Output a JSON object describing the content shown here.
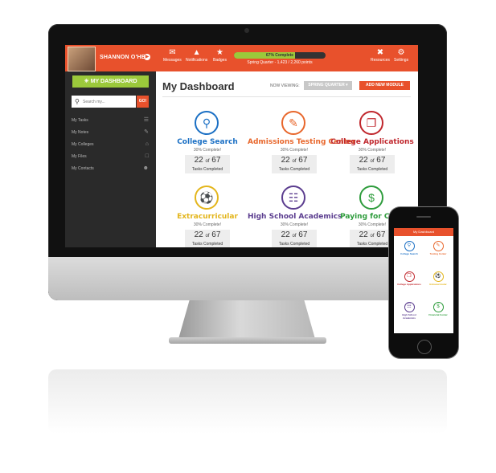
{
  "topbar": {
    "user_name": "SHANNON O'HER",
    "nav": [
      {
        "label": "Messages",
        "icon": "messages-icon"
      },
      {
        "label": "Notifications",
        "icon": "notifications-icon"
      },
      {
        "label": "Badges",
        "icon": "trophy-icon"
      },
      {
        "label": "Resources",
        "icon": "tools-icon"
      },
      {
        "label": "Settings",
        "icon": "gear-icon"
      }
    ],
    "progress": {
      "label": "67% Complete",
      "percent": 0.67,
      "sub": "Spring Quarter - 1,423 / 2,260 points"
    }
  },
  "sidebar": {
    "dashboard_label": "MY DASHBOARD",
    "search_placeholder": "Search my...",
    "go_label": "GO!",
    "items": [
      {
        "label": "My Tasks",
        "icon": "tasks-icon"
      },
      {
        "label": "My Notes",
        "icon": "notes-icon"
      },
      {
        "label": "My Colleges",
        "icon": "college-icon"
      },
      {
        "label": "My Files",
        "icon": "folder-icon"
      },
      {
        "label": "My Contacts",
        "icon": "contacts-icon"
      }
    ]
  },
  "main": {
    "title": "My Dashboard",
    "now_viewing_label": "NOW VIEWING:",
    "quarter": "SPRING QUARTER",
    "add_module_label": "ADD NEW MODULE",
    "cards": [
      {
        "title": "College Search",
        "pct": "30% Complete!",
        "done": "22",
        "of": "of",
        "total": "67",
        "tasks_label": "Tasks Completed",
        "color": "#1a6fc4",
        "icon": "search-icon"
      },
      {
        "title": "Admissions Testing Center",
        "pct": "30% Complete!",
        "done": "22",
        "of": "of",
        "total": "67",
        "tasks_label": "Tasks Completed",
        "color": "#e8672c",
        "icon": "pencil-icon"
      },
      {
        "title": "College Applications",
        "pct": "30% Complete!",
        "done": "22",
        "of": "of",
        "total": "67",
        "tasks_label": "Tasks Completed",
        "color": "#c0272d",
        "icon": "documents-icon"
      },
      {
        "title": "Extracurricular",
        "pct": "30% Complete!",
        "done": "22",
        "of": "of",
        "total": "67",
        "tasks_label": "Tasks Completed",
        "color": "#e3b51b",
        "icon": "activities-icon"
      },
      {
        "title": "High School Academics",
        "pct": "30% Complete!",
        "done": "22",
        "of": "of",
        "total": "67",
        "tasks_label": "Tasks Completed",
        "color": "#5b3d8f",
        "icon": "book-icon"
      },
      {
        "title": "Paying for Colle",
        "pct": "30% Complete!",
        "done": "22",
        "of": "of",
        "total": "67",
        "tasks_label": "Tasks Completed",
        "color": "#2e9c3c",
        "icon": "dollar-icon"
      }
    ]
  },
  "phone": {
    "header": "My Dashboard",
    "cards": [
      {
        "label": "College Search",
        "color": "#1a6fc4"
      },
      {
        "label": "Testing Center",
        "color": "#e8672c"
      },
      {
        "label": "College Applications",
        "color": "#c0272d"
      },
      {
        "label": "Extracurricular",
        "color": "#e3b51b"
      },
      {
        "label": "High School Academics",
        "color": "#5b3d8f"
      },
      {
        "label": "Financial Center",
        "color": "#2e9c3c"
      }
    ]
  }
}
